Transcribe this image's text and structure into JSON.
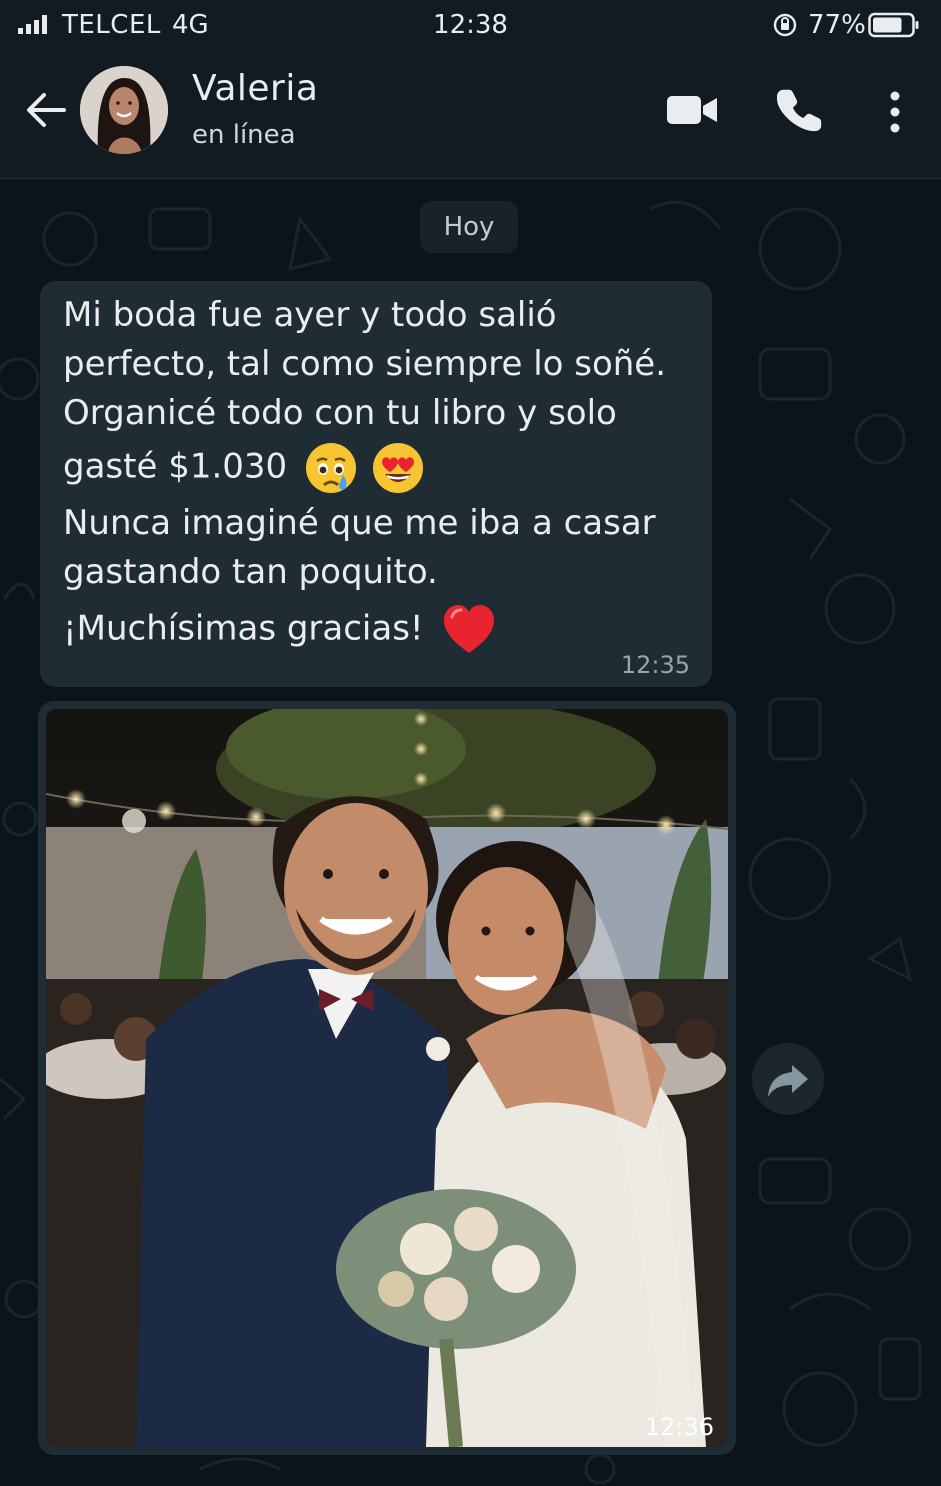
{
  "status_bar": {
    "carrier": "TELCEL",
    "network": "4G",
    "time": "12:38",
    "battery": "77%",
    "battery_level": 0.77
  },
  "header": {
    "contact_name": "Valeria",
    "contact_status": "en línea",
    "icons": [
      "back-arrow-icon",
      "video-camera-icon",
      "phone-icon",
      "more-vertical-icon"
    ]
  },
  "chat": {
    "date_chip": "Hoy",
    "messages": [
      {
        "type": "text",
        "lines": [
          "Mi boda fue ayer y todo salió",
          "perfecto, tal como siempre lo soñé.",
          "Organicé todo con tu libro y solo",
          "gasté $1.030",
          "Nunca imaginé que me iba a casar",
          "gastando tan poquito.",
          "¡Muchísimas gracias!"
        ],
        "emojis": [
          "crying-face-emoji",
          "heart-eyes-emoji",
          "red-heart-emoji"
        ],
        "time": "12:35"
      },
      {
        "type": "image",
        "time": "12:36"
      }
    ]
  },
  "colors": {
    "background": "#0b141a",
    "header": "#111b21",
    "bubble": "#202c33",
    "text": "#e9edef",
    "muted": "#9aa5ab"
  }
}
